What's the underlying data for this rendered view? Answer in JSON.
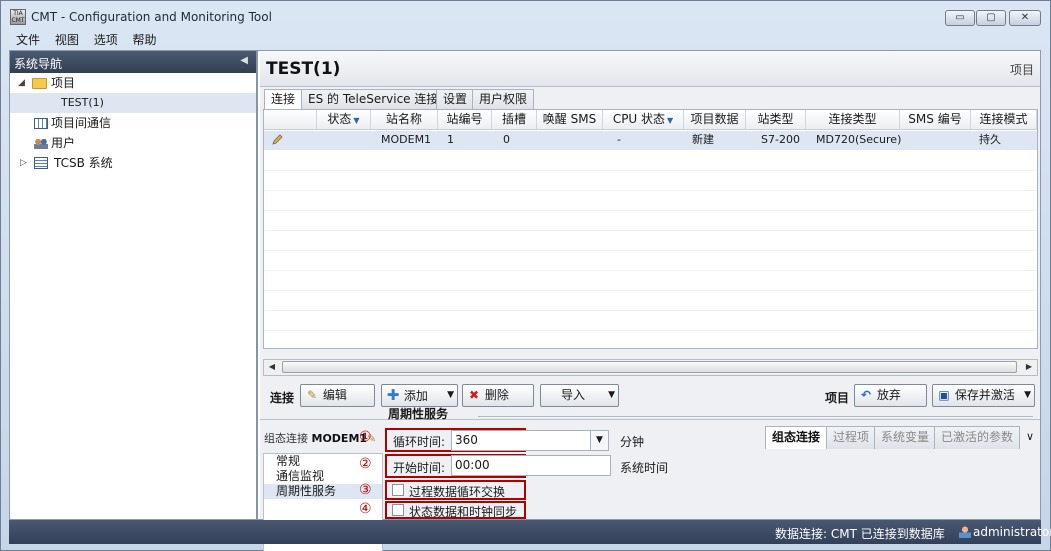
{
  "window": {
    "icon_text": "TIA CMT",
    "title": "CMT - Configuration and Monitoring Tool",
    "btn_min": "▭",
    "btn_max": "▢",
    "btn_close": "✕"
  },
  "menu": [
    "文件",
    "视图",
    "选项",
    "帮助"
  ],
  "nav": {
    "header": "系统导航",
    "collapse": "◀",
    "items": [
      {
        "label": "项目",
        "icon": "folder-icon"
      },
      {
        "label": "TEST(1)",
        "icon": ""
      },
      {
        "label": "项目间通信",
        "icon": "grid-icon"
      },
      {
        "label": "用户",
        "icon": "users-icon"
      },
      {
        "label": "TCSB 系统",
        "icon": "tcsb-icon"
      }
    ],
    "expanded_glyph": "◢",
    "collapsed_glyph": "▷"
  },
  "page": {
    "title": "TEST(1)",
    "kind": "项目"
  },
  "tabs": [
    "连接",
    "ES 的 TeleService 连接",
    "设置",
    "用户权限"
  ],
  "grid": {
    "columns": [
      "",
      "状态",
      "站名称",
      "站编号",
      "插槽",
      "唤醒 SMS",
      "CPU 状态",
      "项目数据",
      "站类型",
      "连接类型",
      "SMS 编号",
      "连接模式"
    ],
    "filter_glyph": "▼",
    "rows": [
      [
        "",
        "",
        "MODEM1",
        "1",
        "0",
        "",
        "-",
        "新建",
        "S7-200",
        "MD720(Secure)",
        "",
        "持久"
      ]
    ],
    "scroll_left": "◀",
    "scroll_right": "▶"
  },
  "toolbar": {
    "label_left": "连接",
    "edit": "编辑",
    "add": "添加",
    "delete": "删除",
    "import": "导入",
    "label_right": "项目",
    "discard": "放弃",
    "save_activate": "保存并激活",
    "dropdown": "▼"
  },
  "lower": {
    "title_prefix": "组态连接",
    "title_name": "MODEM1",
    "tabs": [
      "组态连接",
      "过程项",
      "系统变量",
      "已激活的参数"
    ],
    "more": "∨",
    "subnav": [
      "常规",
      "通信监视",
      "周期性服务"
    ],
    "section_title": "周期性服务",
    "markers": [
      "①",
      "②",
      "③",
      "④"
    ],
    "cycle_label": "循环时间:",
    "cycle_value": "360",
    "cycle_unit": "分钟",
    "start_label": "开始时间:",
    "start_value": "00:00",
    "start_unit": "系统时间",
    "chk1": "过程数据循环交换",
    "chk2": "状态数据和时钟同步",
    "combo_arrow": "▼"
  },
  "status": {
    "connection": "数据连接: CMT 已连接到数据库",
    "user": "administrator"
  }
}
